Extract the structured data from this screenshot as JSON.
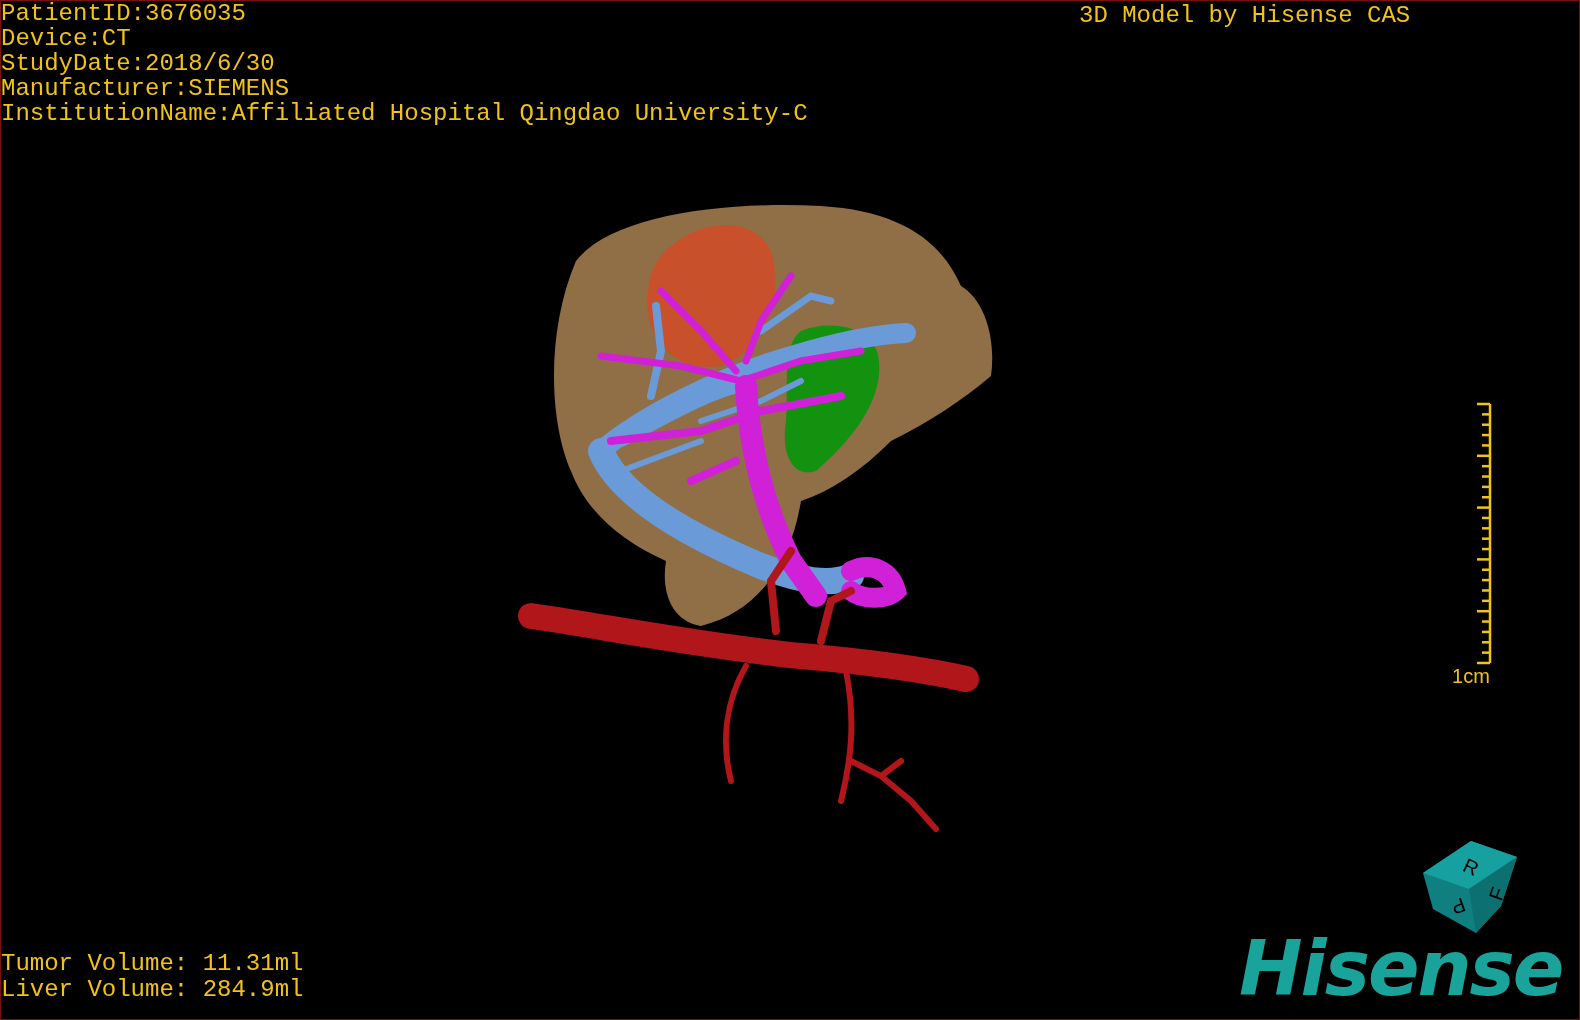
{
  "info_lines": [
    "PatientID:3676035",
    "Device:CT",
    "StudyDate:2018/6/30",
    "Manufacturer:SIEMENS",
    "InstitutionName:Affiliated Hospital Qingdao University-C"
  ],
  "title": "3D Model by Hisense CAS",
  "scale_bar": {
    "label": "1cm"
  },
  "orientation_cube": {
    "faces": [
      "R",
      "F",
      "P"
    ]
  },
  "volumes": [
    "Tumor Volume: 11.31ml",
    "Liver Volume: 284.9ml"
  ],
  "logo": "Hisense"
}
